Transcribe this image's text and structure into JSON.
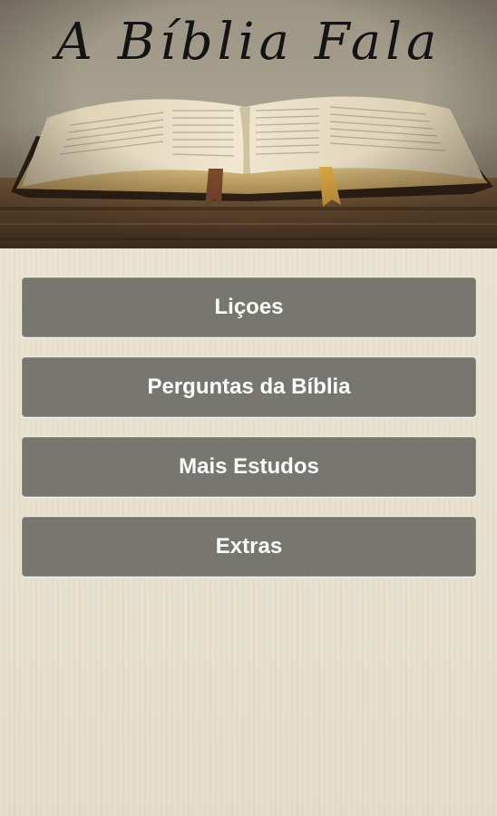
{
  "header": {
    "title": "A Bíblia Fala"
  },
  "menu": {
    "items": [
      {
        "label": "Liçoes"
      },
      {
        "label": "Perguntas da Bíblia"
      },
      {
        "label": "Mais Estudos"
      },
      {
        "label": "Extras"
      }
    ]
  },
  "colors": {
    "button_bg": "#777770",
    "button_text": "#ffffff",
    "background": "#e8e1cf"
  }
}
